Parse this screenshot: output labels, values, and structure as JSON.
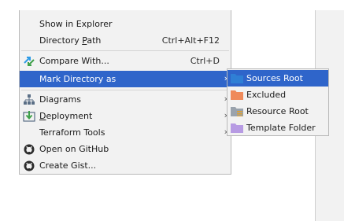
{
  "menu": {
    "items": [
      {
        "label": "Show in Explorer",
        "shortcut": "",
        "icon": "",
        "submenu": false
      },
      {
        "label_pre": "Directory ",
        "label_mnemonic": "P",
        "label_post": "ath",
        "shortcut": "Ctrl+Alt+F12",
        "icon": "",
        "submenu": false
      },
      {
        "label": "Compare With...",
        "shortcut": "Ctrl+D",
        "icon": "compare-arrows-icon",
        "submenu": false
      },
      {
        "label": "Mark Directory as",
        "shortcut": "",
        "icon": "",
        "submenu": true,
        "selected": true
      },
      {
        "label": "Diagrams",
        "shortcut": "",
        "icon": "diagram-hierarchy-icon",
        "submenu": true
      },
      {
        "label_pre": "",
        "label_mnemonic": "D",
        "label_post": "eployment",
        "shortcut": "",
        "icon": "deployment-icon",
        "submenu": true
      },
      {
        "label": "Terraform Tools",
        "shortcut": "",
        "icon": "",
        "submenu": true
      },
      {
        "label": "Open on GitHub",
        "shortcut": "",
        "icon": "github-icon",
        "submenu": false
      },
      {
        "label": "Create Gist...",
        "shortcut": "",
        "icon": "github-gist-icon",
        "submenu": false
      }
    ],
    "arrow_glyph": "›"
  },
  "submenu": {
    "items": [
      {
        "label": "Sources Root",
        "icon": "sources-root-folder-icon",
        "color": "#2f7fd5",
        "selected": true
      },
      {
        "label": "Excluded",
        "icon": "excluded-folder-icon",
        "color": "#ef8a5a"
      },
      {
        "label": "Resource Root",
        "icon": "resource-root-folder-icon",
        "color": "#9aa3ad"
      },
      {
        "label": "Template Folder",
        "icon": "template-folder-icon",
        "color": "#b79be3"
      }
    ]
  },
  "colors": {
    "menu_bg": "#f2f2f2",
    "selection": "#2f65ca",
    "border": "#b9b9b9"
  }
}
